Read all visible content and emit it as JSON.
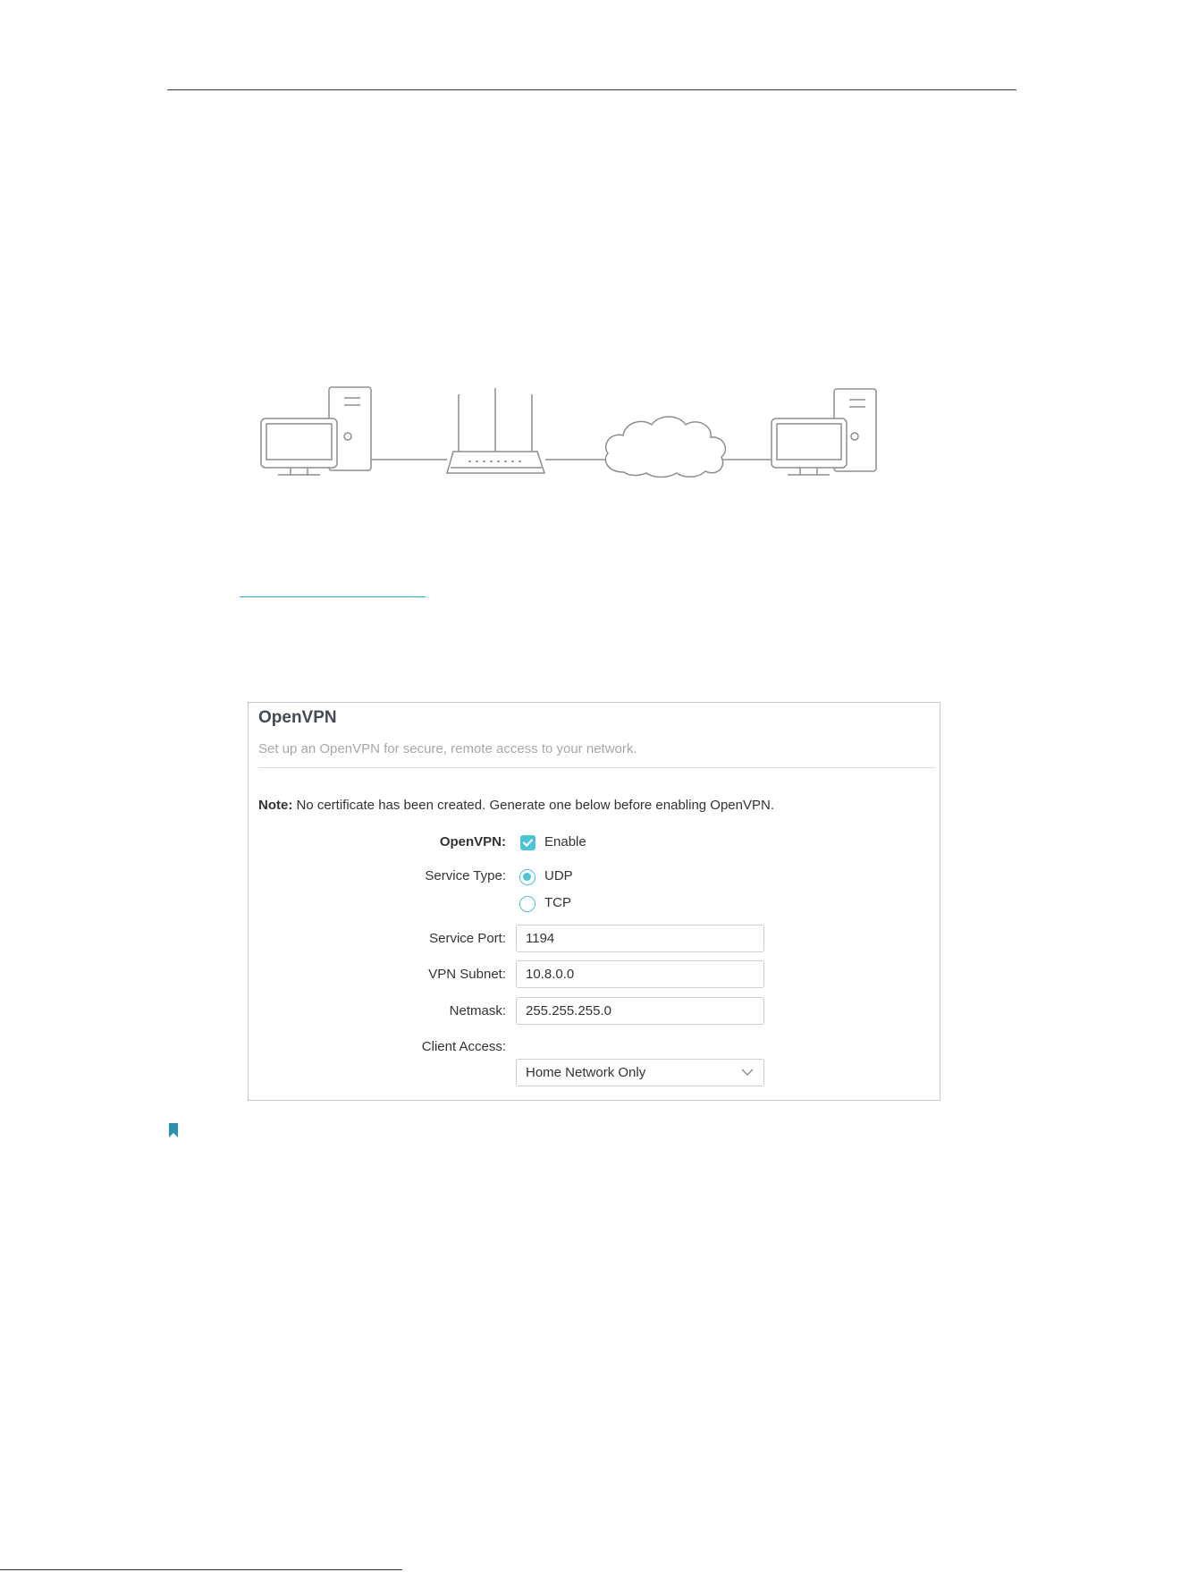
{
  "panel": {
    "title": "OpenVPN",
    "subtitle": "Set up an OpenVPN for secure, remote access to your network.",
    "note_label": "Note:",
    "note_text": " No certificate has been created. Generate one below before enabling OpenVPN."
  },
  "form": {
    "openvpn_label": "OpenVPN:",
    "enable_label": "Enable",
    "service_type_label": "Service Type:",
    "udp_label": "UDP",
    "tcp_label": "TCP",
    "service_port_label": "Service Port:",
    "service_port_value": "1194",
    "vpn_subnet_label": "VPN Subnet:",
    "vpn_subnet_value": "10.8.0.0",
    "netmask_label": "Netmask:",
    "netmask_value": "255.255.255.0",
    "client_access_label": "Client Access:",
    "client_access_value": "Home Network Only"
  },
  "colors": {
    "accent": "#4dc3d6",
    "link": "#2aa8c4",
    "bookmark": "#2b8fb0"
  }
}
